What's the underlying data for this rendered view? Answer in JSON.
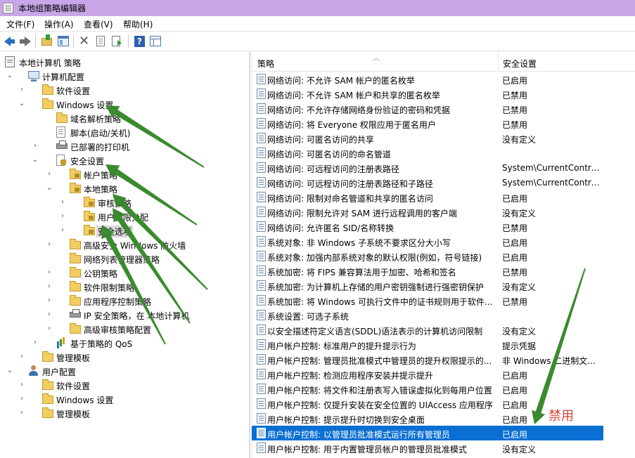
{
  "window": {
    "title": "本地组策略编辑器"
  },
  "menu": {
    "items": [
      "文件(F)",
      "操作(A)",
      "查看(V)",
      "帮助(H)"
    ]
  },
  "toolbar": {
    "buttons": [
      "back-icon",
      "forward-icon",
      "up-folder-icon",
      "show-hide-tree-icon",
      "delete-icon",
      "properties-icon",
      "export-list-icon",
      "help-icon",
      "console-tree-icon"
    ]
  },
  "tree": {
    "nodes": [
      {
        "label": "本地计算机 策略",
        "icon": "policy-scroll-icon",
        "expander": ""
      },
      {
        "label": "计算机配置",
        "icon": "computer-icon",
        "expander": "expanded"
      },
      {
        "label": "软件设置",
        "icon": "folder-icon",
        "expander": "collapsed"
      },
      {
        "label": "Windows 设置",
        "icon": "folder-icon",
        "expander": "expanded"
      },
      {
        "label": "域名解析策略",
        "icon": "folder-icon",
        "expander": ""
      },
      {
        "label": "脚本(启动/关机)",
        "icon": "script-icon",
        "expander": ""
      },
      {
        "label": "已部署的打印机",
        "icon": "printer-icon",
        "expander": "collapsed"
      },
      {
        "label": "安全设置",
        "icon": "security-icon",
        "expander": "expanded"
      },
      {
        "label": "帐户策略",
        "icon": "lock-folder-icon",
        "expander": "collapsed"
      },
      {
        "label": "本地策略",
        "icon": "lock-folder-icon",
        "expander": "expanded"
      },
      {
        "label": "审核策略",
        "icon": "lock-folder-icon",
        "expander": "collapsed"
      },
      {
        "label": "用户权限分配",
        "icon": "lock-folder-icon",
        "expander": "collapsed"
      },
      {
        "label": "安全选项",
        "icon": "lock-folder-icon",
        "expander": "collapsed",
        "selected": true
      },
      {
        "label": "高级安全 Windows 防火墙",
        "icon": "folder-icon",
        "expander": "collapsed"
      },
      {
        "label": "网络列表管理器策略",
        "icon": "folder-icon",
        "expander": ""
      },
      {
        "label": "公钥策略",
        "icon": "folder-icon",
        "expander": "collapsed"
      },
      {
        "label": "软件限制策略",
        "icon": "folder-icon",
        "expander": "collapsed"
      },
      {
        "label": "应用程序控制策略",
        "icon": "folder-icon",
        "expander": "collapsed"
      },
      {
        "label": "IP 安全策略，在 本地计算机",
        "icon": "ip-security-icon",
        "expander": "collapsed"
      },
      {
        "label": "高级审核策略配置",
        "icon": "folder-icon",
        "expander": "collapsed"
      },
      {
        "label": "基于策略的 QoS",
        "icon": "qos-chart-icon",
        "expander": "collapsed"
      },
      {
        "label": "管理模板",
        "icon": "folder-icon",
        "expander": "collapsed"
      },
      {
        "label": "用户配置",
        "icon": "user-icon",
        "expander": "expanded"
      },
      {
        "label": "软件设置",
        "icon": "folder-icon",
        "expander": "collapsed"
      },
      {
        "label": "Windows 设置",
        "icon": "folder-icon",
        "expander": "collapsed"
      },
      {
        "label": "管理模板",
        "icon": "folder-icon",
        "expander": "collapsed"
      }
    ]
  },
  "list": {
    "columns": {
      "policy": "策略",
      "setting": "安全设置"
    },
    "rows": [
      {
        "policy": "网络访问: 不允许 SAM 帐户的匿名枚举",
        "setting": "已启用"
      },
      {
        "policy": "网络访问: 不允许 SAM 帐户和共享的匿名枚举",
        "setting": "已禁用"
      },
      {
        "policy": "网络访问: 不允许存储网络身份验证的密码和凭据",
        "setting": "已禁用"
      },
      {
        "policy": "网络访问: 将 Everyone 权限应用于匿名用户",
        "setting": "已禁用"
      },
      {
        "policy": "网络访问: 可匿名访问的共享",
        "setting": "没有定义"
      },
      {
        "policy": "网络访问: 可匿名访问的命名管道",
        "setting": ""
      },
      {
        "policy": "网络访问: 可远程访问的注册表路径",
        "setting": "System\\CurrentContro..."
      },
      {
        "policy": "网络访问: 可远程访问的注册表路径和子路径",
        "setting": "System\\CurrentContro..."
      },
      {
        "policy": "网络访问: 限制对命名管道和共享的匿名访问",
        "setting": "已启用"
      },
      {
        "policy": "网络访问: 限制允许对 SAM 进行远程调用的客户端",
        "setting": "没有定义"
      },
      {
        "policy": "网络访问: 允许匿名 SID/名称转换",
        "setting": "已禁用"
      },
      {
        "policy": "系统对象: 非 Windows 子系统不要求区分大小写",
        "setting": "已启用"
      },
      {
        "policy": "系统对象: 加强内部系统对象的默认权限(例如，符号链接)",
        "setting": "已启用"
      },
      {
        "policy": "系统加密: 将 FIPS 兼容算法用于加密、哈希和签名",
        "setting": "已禁用"
      },
      {
        "policy": "系统加密: 为计算机上存储的用户密钥强制进行强密钥保护",
        "setting": "没有定义"
      },
      {
        "policy": "系统加密: 将 Windows 可执行文件中的证书规则用于软件...",
        "setting": "已禁用"
      },
      {
        "policy": "系统设置: 可选子系统",
        "setting": ""
      },
      {
        "policy": "以安全描述符定义语言(SDDL)语法表示的计算机访问限制",
        "setting": "没有定义"
      },
      {
        "policy": "用户帐户控制: 标准用户的提升提示行为",
        "setting": "提示凭据"
      },
      {
        "policy": "用户帐户控制: 管理员批准模式中管理员的提升权限提示的...",
        "setting": "非 Windows 二进制文..."
      },
      {
        "policy": "用户帐户控制: 检测应用程序安装并提示提升",
        "setting": "已启用"
      },
      {
        "policy": "用户帐户控制: 将文件和注册表写入错误虚拟化到每用户位置",
        "setting": "已启用"
      },
      {
        "policy": "用户帐户控制: 仅提升安装在安全位置的 UIAccess 应用程序",
        "setting": "已启用"
      },
      {
        "policy": "用户帐户控制: 提示提升时切换到安全桌面",
        "setting": "已启用"
      },
      {
        "policy": "用户帐户控制: 以管理员批准模式运行所有管理员",
        "setting": "已启用",
        "selected": true
      },
      {
        "policy": "用户帐户控制: 用于内置管理员帐户的管理员批准模式",
        "setting": "没有定义"
      }
    ]
  },
  "annotation": {
    "text": "禁用",
    "arrow_color": "#3a8a2e",
    "text_color": "#d9433b"
  },
  "colors": {
    "titlebar": "#c8a6e8",
    "selection": "#0a6fd3",
    "tree_selection": "#d9d9d9"
  }
}
